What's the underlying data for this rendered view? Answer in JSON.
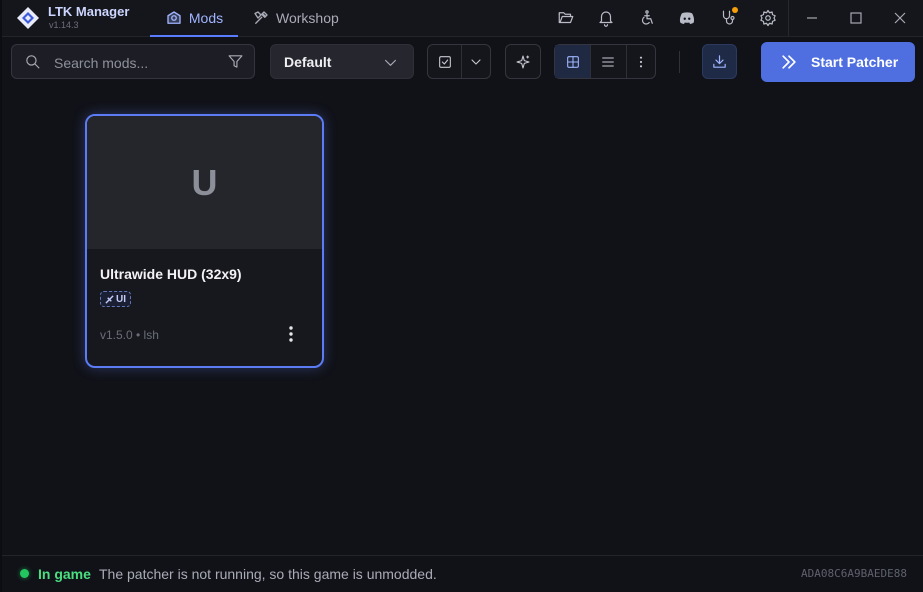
{
  "app": {
    "name": "LTK Manager",
    "version": "v1.14.3"
  },
  "tabs": [
    {
      "label": "Mods",
      "active": true
    },
    {
      "label": "Workshop",
      "active": false
    }
  ],
  "titlebar_icons": [
    "folder-open-icon",
    "bell-icon",
    "accessibility-icon",
    "discord-icon",
    "stethoscope-icon",
    "gear-icon"
  ],
  "window_controls": [
    "minimize-icon",
    "maximize-icon",
    "close-icon"
  ],
  "toolbar": {
    "search_placeholder": "Search mods...",
    "search_value": "",
    "profile_select": "Default",
    "start_label": "Start Patcher"
  },
  "colors": {
    "accent": "#5b7cf5",
    "start_button": "#4f6fe0",
    "status_ok": "#22c55e"
  },
  "mods": [
    {
      "initial": "U",
      "title": "Ultrawide HUD (32x9)",
      "tag": "UI",
      "version": "v1.5.0",
      "author": "lsh",
      "meta": "v1.5.0 • lsh"
    }
  ],
  "status": {
    "label": "In game",
    "message": "The patcher is not running, so this game is unmodded.",
    "hash": "ADA08C6A9BAEDE88"
  }
}
